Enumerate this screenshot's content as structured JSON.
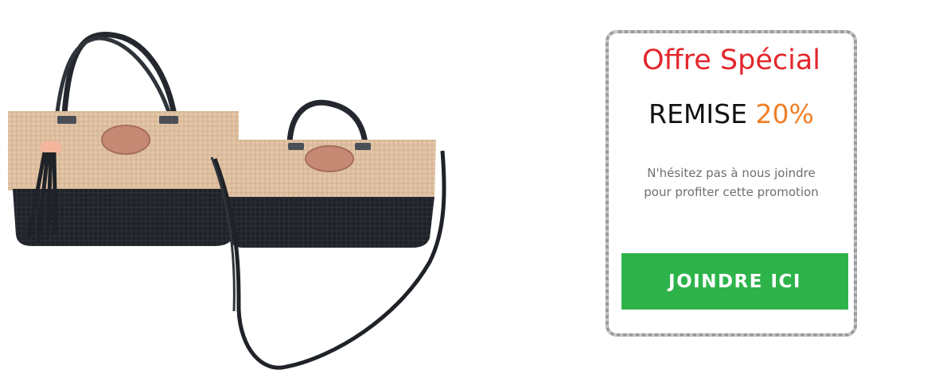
{
  "product": {
    "icon": "tote-bags-photo"
  },
  "promo": {
    "title": "Offre Spécial",
    "discount_label": "REMISE",
    "discount_value": "20%",
    "text_line1": "N'hésitez pas à nous joindre",
    "text_line2": "pour profiter cette promotion",
    "button_label": "JOINDRE ICI",
    "colors": {
      "title": "#e3262b",
      "discount_value": "#f07f28",
      "button": "#2db34a"
    }
  }
}
